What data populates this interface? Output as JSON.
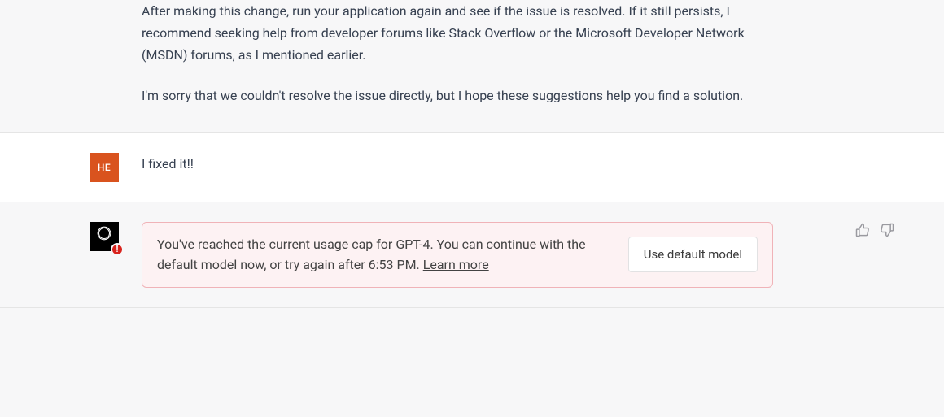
{
  "assistant_prev": {
    "p1": "After making this change, run your application again and see if the issue is resolved. If it still persists, I recommend seeking help from developer forums like Stack Overflow or the Microsoft Developer Network (MSDN) forums, as I mentioned earlier.",
    "p2": "I'm sorry that we couldn't resolve the issue directly, but I hope these suggestions help you find a solution."
  },
  "user": {
    "avatar_initials": "HE",
    "message": "I fixed it!!"
  },
  "notice": {
    "text_before_link": "You've reached the current usage cap for GPT-4. You can continue with the default model now, or try again after 6:53 PM. ",
    "link_label": "Learn more",
    "button_label": "Use default model",
    "error_badge": "!"
  }
}
